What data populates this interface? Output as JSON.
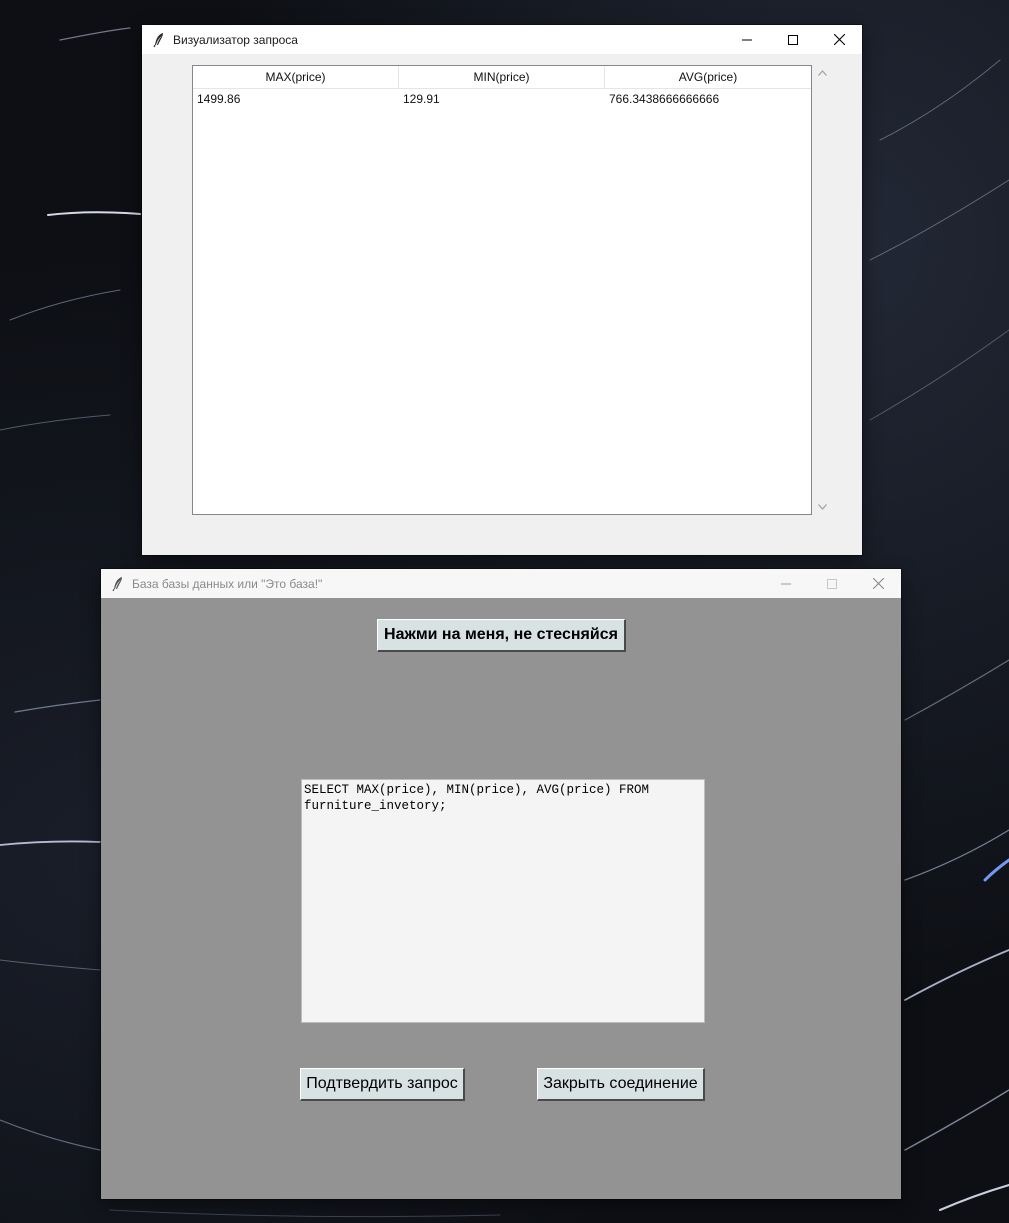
{
  "visualizer_window": {
    "title": "Визуализатор запроса",
    "icon": "feather-icon",
    "columns": [
      "MAX(price)",
      "MIN(price)",
      "AVG(price)"
    ],
    "rows": [
      [
        "1499.86",
        "129.91",
        "766.3438666666666"
      ]
    ]
  },
  "main_window": {
    "title": "База базы данных или \"Это база!\"",
    "icon": "feather-icon",
    "press_button_label": "Нажми на меня, не стесняйся",
    "query_text": "SELECT MAX(price), MIN(price), AVG(price) FROM\nfurniture_invetory;",
    "confirm_button_label": "Подтвердить запрос",
    "close_button_label": "Закрыть соединение",
    "background_color": "#939393",
    "button_color": "#d8e2e2"
  }
}
